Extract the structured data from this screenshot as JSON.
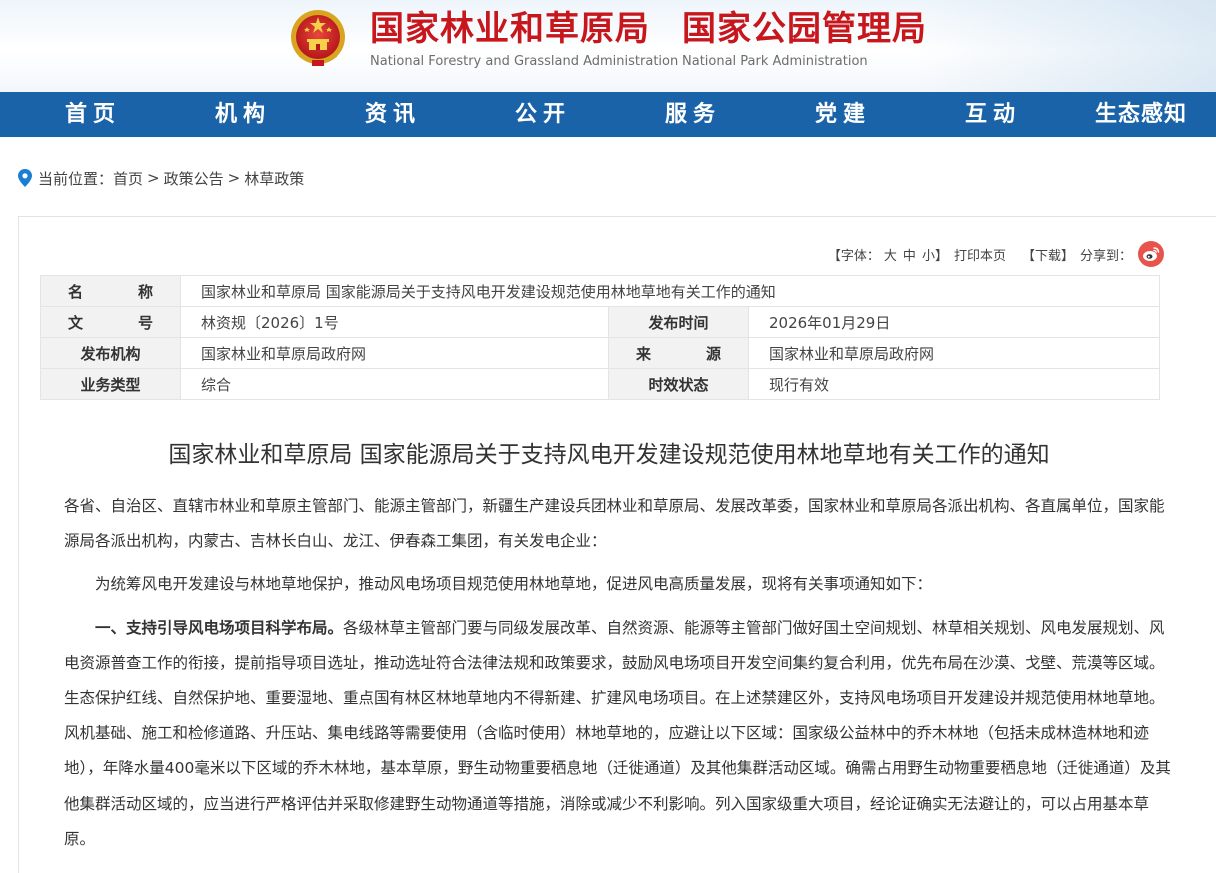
{
  "header": {
    "title_cn_1": "国家林业和草原局",
    "title_cn_2": "国家公园管理局",
    "title_en_1": "National Forestry and Grassland Administration",
    "title_en_2": "National Park Administration",
    "emblem_icon": "national-emblem-icon",
    "brand_red": "#c8161d"
  },
  "nav": {
    "bg_color": "#1a63a8",
    "items": [
      "首页",
      "机构",
      "资讯",
      "公开",
      "服务",
      "党建",
      "互动",
      "生态感知"
    ]
  },
  "breadcrumb": {
    "label": "当前位置：",
    "items": [
      "首页",
      "政策公告",
      "林草政策"
    ],
    "separator": ">"
  },
  "toolbar": {
    "font_label": "【字体：",
    "size_large": "大",
    "size_medium": "中",
    "size_small": "小】",
    "print": "打印本页",
    "download": "【下载】",
    "share": "分享到：",
    "share_icon": "weibo-icon"
  },
  "meta": {
    "name_label": "名　称",
    "name_value": "国家林业和草原局 国家能源局关于支持风电开发建设规范使用林地草地有关工作的通知",
    "doc_no_label": "文　号",
    "doc_no_value": "林资规〔2026〕1号",
    "pub_date_label": "发布时间",
    "pub_date_value": "2026年01月29日",
    "org_label": "发布机构",
    "org_value": "国家林业和草原局政府网",
    "source_label": "来　源",
    "source_value": "国家林业和草原局政府网",
    "type_label": "业务类型",
    "type_value": "综合",
    "status_label": "时效状态",
    "status_value": "现行有效"
  },
  "article": {
    "title": "国家林业和草原局 国家能源局关于支持风电开发建设规范使用林地草地有关工作的通知",
    "salutation": "各省、自治区、直辖市林业和草原主管部门、能源主管部门，新疆生产建设兵团林业和草原局、发展改革委，国家林业和草原局各派出机构、各直属单位，国家能源局各派出机构，内蒙古、吉林长白山、龙江、伊春森工集团，有关发电企业：",
    "intro": "为统筹风电开发建设与林地草地保护，推动风电场项目规范使用林地草地，促进风电高质量发展，现将有关事项通知如下：",
    "section1_heading": "一、支持引导风电场项目科学布局。",
    "section1_body": "各级林草主管部门要与同级发展改革、自然资源、能源等主管部门做好国土空间规划、林草相关规划、风电发展规划、风电资源普查工作的衔接，提前指导项目选址，推动选址符合法律法规和政策要求，鼓励风电场项目开发空间集约复合利用，优先布局在沙漠、戈壁、荒漠等区域。生态保护红线、自然保护地、重要湿地、重点国有林区林地草地内不得新建、扩建风电场项目。在上述禁建区外，支持风电场项目开发建设并规范使用林地草地。风机基础、施工和检修道路、升压站、集电线路等需要使用（含临时使用）林地草地的，应避让以下区域：国家级公益林中的乔木林地（包括未成林造林地和迹地），年降水量400毫米以下区域的乔木林地，基本草原，野生动物重要栖息地（迁徙通道）及其他集群活动区域。确需占用野生动物重要栖息地（迁徙通道）及其他集群活动区域的，应当进行严格评估并采取修建野生动物通道等措施，消除或减少不利影响。列入国家级重大项目，经论证确实无法避让的，可以占用基本草原。"
  }
}
